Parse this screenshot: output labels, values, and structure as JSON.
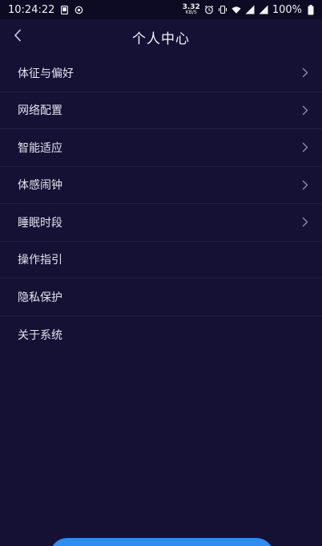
{
  "status_bar": {
    "time": "10:24:22",
    "net_speed_value": "3.32",
    "net_speed_unit": "KB/S",
    "battery_percent": "100%"
  },
  "header": {
    "title": "个人中心"
  },
  "menu": {
    "items": [
      {
        "label": "体征与偏好",
        "has_arrow": true
      },
      {
        "label": "网络配置",
        "has_arrow": true
      },
      {
        "label": "智能适应",
        "has_arrow": true
      },
      {
        "label": "体感闹钟",
        "has_arrow": true
      },
      {
        "label": "睡眠时段",
        "has_arrow": true
      },
      {
        "label": "操作指引",
        "has_arrow": false
      },
      {
        "label": "隐私保护",
        "has_arrow": false
      },
      {
        "label": "关于系统",
        "has_arrow": false
      }
    ]
  },
  "colors": {
    "background": "#151135",
    "status_bar": "#0d0b24",
    "divider": "#221d47",
    "text": "#e3e3ef",
    "chevron": "#8c8ca8",
    "bottom_button": "#2f8cf0"
  },
  "icons": {
    "back": "chevron-left-icon",
    "row_arrow": "chevron-right-icon"
  }
}
